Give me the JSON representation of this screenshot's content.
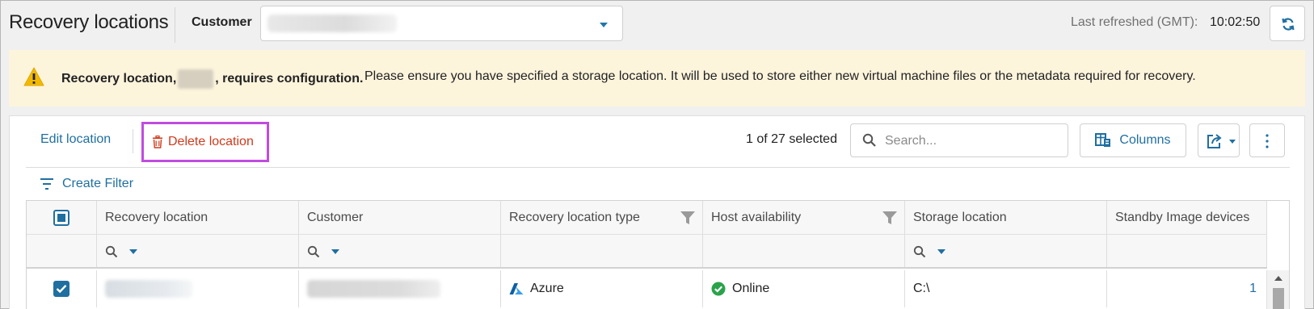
{
  "header": {
    "title": "Recovery locations",
    "customer_label": "Customer",
    "customer_value": "",
    "last_refreshed_label": "Last refreshed (GMT):",
    "last_refreshed_time": "10:02:50"
  },
  "banner": {
    "strong_prefix": "Recovery location,",
    "strong_suffix": ", requires configuration.",
    "message": "Please ensure you have specified a storage location. It will be used to store either new virtual machine files or the metadata required for recovery.",
    "icon": "warning-icon"
  },
  "toolbar": {
    "edit_label": "Edit location",
    "delete_label": "Delete location",
    "selected_text": "1 of 27 selected",
    "search_placeholder": "Search...",
    "columns_label": "Columns",
    "create_filter_label": "Create Filter"
  },
  "grid": {
    "columns": [
      "Recovery location",
      "Customer",
      "Recovery location type",
      "Host availability",
      "Storage location",
      "Standby Image devices"
    ],
    "rows": [
      {
        "selected": true,
        "recovery_location": "",
        "customer": "",
        "type": "Azure",
        "host_availability": "Online",
        "storage_location": "C:\\",
        "standby_image_devices": "1"
      }
    ]
  },
  "colors": {
    "accent": "#1f6fa0",
    "danger": "#cf3a1c",
    "highlight_outline": "#c04ce0",
    "banner_bg": "#fdf4dc",
    "warning": "#f2b900",
    "online": "#2aa34a"
  }
}
